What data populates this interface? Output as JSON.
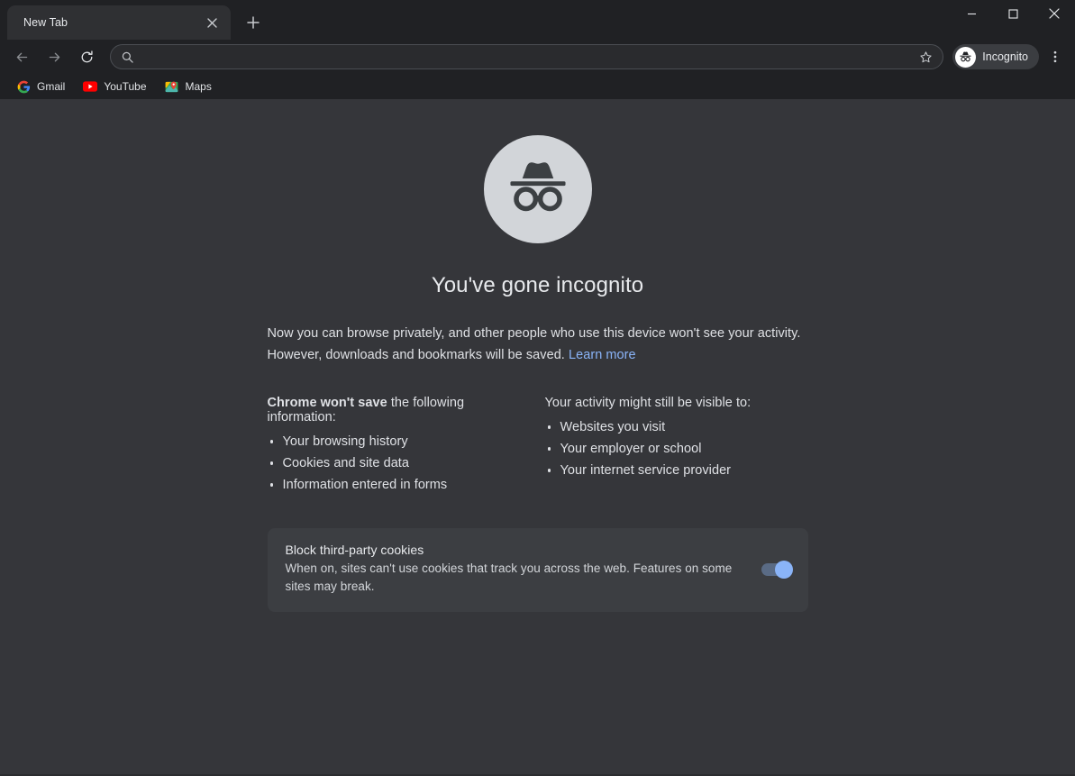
{
  "window": {
    "minimize_label": "Minimize",
    "maximize_label": "Maximize",
    "close_label": "Close"
  },
  "tabstrip": {
    "tabs": [
      {
        "title": "New Tab",
        "close_label": "Close tab",
        "active": true
      }
    ],
    "new_tab_label": "New tab"
  },
  "toolbar": {
    "back_label": "Back",
    "forward_label": "Forward",
    "reload_label": "Reload",
    "omnibox": {
      "value": "",
      "placeholder": "",
      "search_icon": "search-icon"
    },
    "bookmark_star_label": "Bookmark this tab",
    "profile_chip": {
      "label": "Incognito",
      "icon": "incognito-icon"
    },
    "menu_label": "Customize and control Google Chrome"
  },
  "bookmarks": [
    {
      "label": "Gmail",
      "icon": "gmail-icon"
    },
    {
      "label": "YouTube",
      "icon": "youtube-icon"
    },
    {
      "label": "Maps",
      "icon": "maps-icon"
    }
  ],
  "page": {
    "hero_icon": "incognito-icon",
    "headline": "You've gone incognito",
    "intro_line1": "Now you can browse privately, and other people who use this device won't see your activity.",
    "intro_line2": "However, downloads and bookmarks will be saved.",
    "learn_more": "Learn more",
    "columns": [
      {
        "head_bold": "Chrome won't save",
        "head_rest": " the following information:",
        "items": [
          "Your browsing history",
          "Cookies and site data",
          "Information entered in forms"
        ]
      },
      {
        "head_bold": "",
        "head_rest": "Your activity might still be visible to:",
        "items": [
          "Websites you visit",
          "Your employer or school",
          "Your internet service provider"
        ]
      }
    ],
    "cookie_card": {
      "title": "Block third-party cookies",
      "description": "When on, sites can't use cookies that track you across the web. Features on some sites may break.",
      "toggle_state": "on",
      "toggle_label": "Block third-party cookies toggle"
    }
  },
  "colors": {
    "window_bg": "#202124",
    "tab_active": "#2f3033",
    "page_bg": "#35363a",
    "card_bg": "#3c3e42",
    "accent_blue": "#8ab4f8",
    "toggle_track": "#5a6b85",
    "hero_circle": "#d2d5d9",
    "text_primary": "#e8eaed"
  }
}
